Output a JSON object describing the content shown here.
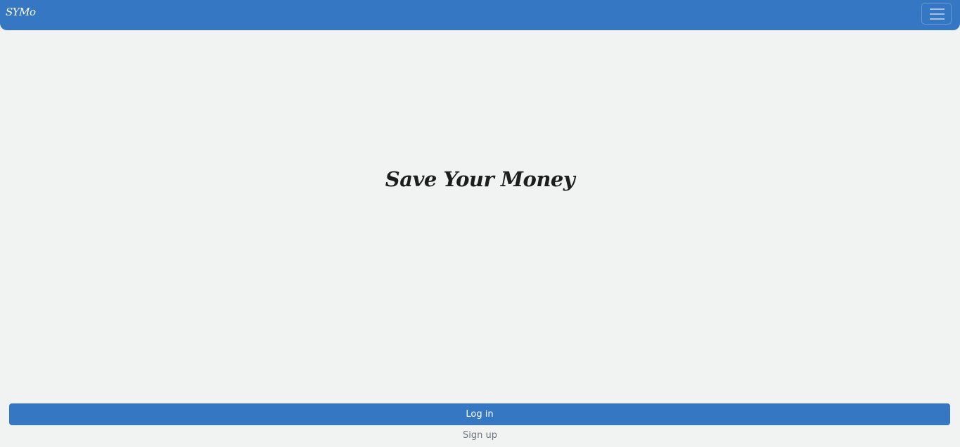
{
  "navbar": {
    "brand": "SYMo",
    "toggler_icon": "hamburger-menu-icon",
    "background_color": "#3577c3"
  },
  "hero": {
    "title": "Save Your Money"
  },
  "actions": {
    "login_label": "Log in",
    "signup_label": "Sign up",
    "primary_color": "#3577c3",
    "link_color": "#6c757d"
  }
}
